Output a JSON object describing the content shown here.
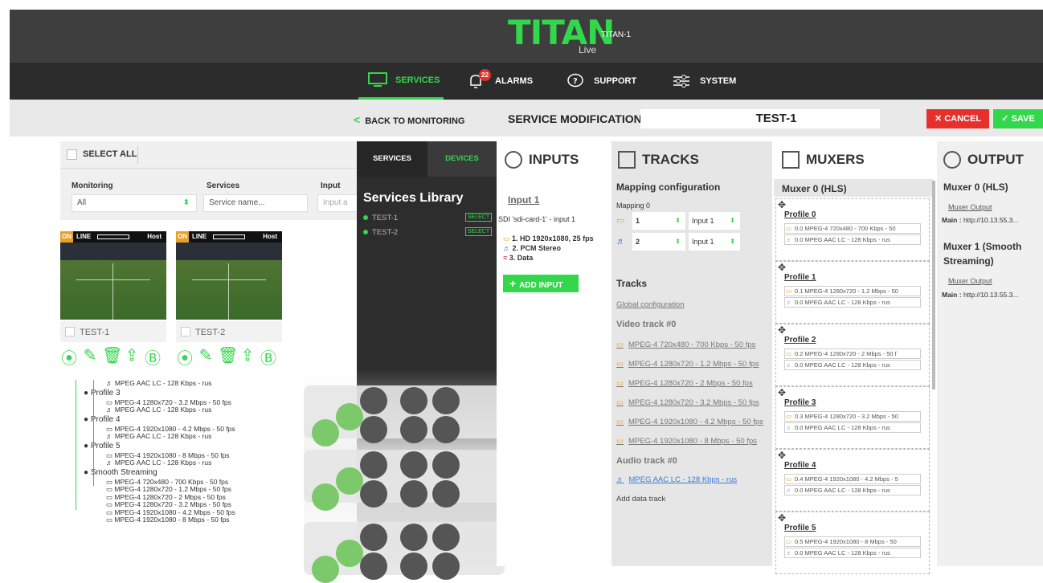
{
  "header": {
    "logo": "TITAN",
    "logo_sub": "Live",
    "device": "TITAN-1"
  },
  "nav": {
    "services": "SERVICES",
    "alarms": "ALARMS",
    "alarm_count": "22",
    "support": "SUPPORT",
    "system": "SYSTEM"
  },
  "toolbar": {
    "back": "BACK TO MONITORING",
    "modification_label": "SERVICE MODIFICATION :",
    "service_name": "TEST-1",
    "cancel": "CANCEL",
    "save": "SAVE"
  },
  "monitoring": {
    "select_all": "SELECT ALL",
    "filter_monitoring_label": "Monitoring",
    "filter_monitoring_value": "All",
    "filter_services_label": "Services",
    "filter_services_placeholder": "Service name...",
    "filter_input_label": "Input",
    "filter_input_placeholder": "Input a",
    "cards": [
      {
        "name": "TEST-1",
        "on": "ON",
        "line": "LINE",
        "host": "Host"
      },
      {
        "name": "TEST-2",
        "on": "ON",
        "line": "LINE",
        "host": "Host"
      }
    ]
  },
  "tree": {
    "items": [
      {
        "c": "l1",
        "t": "♬ MPEG AAC LC - 128 Kbps - rus"
      },
      {
        "c": "grp",
        "t": "● Profile 3"
      },
      {
        "c": "l1",
        "t": "▭ MPEG-4 1280x720 - 3.2 Mbps - 50 fps"
      },
      {
        "c": "l1",
        "t": "♬ MPEG AAC LC - 128 Kbps - rus"
      },
      {
        "c": "grp",
        "t": "● Profile 4"
      },
      {
        "c": "l1",
        "t": "▭ MPEG-4 1920x1080 - 4.2 Mbps - 50 fps"
      },
      {
        "c": "l1",
        "t": "♬ MPEG AAC LC - 128 Kbps - rus"
      },
      {
        "c": "grp",
        "t": "● Profile 5"
      },
      {
        "c": "l1",
        "t": "▭ MPEG-4 1920x1080 - 8 Mbps - 50 fps"
      },
      {
        "c": "l1",
        "t": "♬ MPEG AAC LC - 128 Kbps - rus"
      },
      {
        "c": "grp",
        "t": "● Smooth Streaming"
      },
      {
        "c": "l1",
        "t": "▭ MPEG-4 720x480 - 700 Kbps - 50 fps"
      },
      {
        "c": "l1",
        "t": "▭ MPEG-4 1280x720 - 1.2 Mbps - 50 fps"
      },
      {
        "c": "l1",
        "t": "▭ MPEG-4 1280x720 - 2 Mbps - 50 fps"
      },
      {
        "c": "l1",
        "t": "▭ MPEG-4 1280x720 - 3.2 Mbps - 50 fps"
      },
      {
        "c": "l1",
        "t": "▭ MPEG-4 1920x1080 - 4.2 Mbps - 50 fps"
      },
      {
        "c": "l1",
        "t": "▭ MPEG-4 1920x1080 - 8 Mbps - 50 fps"
      }
    ]
  },
  "library": {
    "tab_services": "SERVICES",
    "tab_devices": "DEVICES",
    "title": "Services Library",
    "select": "SELECT",
    "items": [
      "TEST-1",
      "TEST-2"
    ]
  },
  "inputs": {
    "title": "INPUTS",
    "input_name": "Input 1",
    "input_desc": "SDI 'sdi-card-1' - input 1",
    "lines": [
      "1. HD 1920x1080, 25 fps",
      "2. PCM Stereo",
      "3. Data"
    ],
    "add": "ADD INPUT"
  },
  "tracks": {
    "title": "TRACKS",
    "mapping_title": "Mapping configuration",
    "mapping_label": "Mapping 0",
    "map_rows": [
      {
        "a": "1",
        "b": "Input 1"
      },
      {
        "a": "2",
        "b": "Input 1"
      }
    ],
    "tracks_title": "Tracks",
    "global": "Global configuration",
    "video_title": "Video track #0",
    "video": [
      "MPEG-4 720x480 - 700 Kbps - 50 fps",
      "MPEG-4 1280x720 - 1.2 Mbps - 50 fps",
      "MPEG-4 1280x720 - 2 Mbps - 50 fps",
      "MPEG-4 1280x720 - 3.2 Mbps - 50 fps",
      "MPEG-4 1920x1080 - 4.2 Mbps - 50 fps",
      "MPEG-4 1920x1080 - 8 Mbps - 50 fps"
    ],
    "audio_title": "Audio track #0",
    "audio": "MPEG AAC LC - 128 Kbps - rus",
    "add_data": "Add data track"
  },
  "muxers": {
    "title": "MUXERS",
    "mux0": "Muxer 0 (HLS)",
    "profiles": [
      {
        "name": "Profile 0",
        "v": "0.0 MPEG-4 720x480 - 700 Kbps - 50",
        "a": "0.0 MPEG AAC LC - 128 Kbps - rus"
      },
      {
        "name": "Profile 1",
        "v": "0.1 MPEG-4 1280x720 - 1.2 Mbps - 50",
        "a": "0.0 MPEG AAC LC - 128 Kbps - rus"
      },
      {
        "name": "Profile 2",
        "v": "0.2 MPEG-4 1280x720 - 2 Mbps - 50 f",
        "a": "0.0 MPEG AAC LC - 128 Kbps - rus"
      },
      {
        "name": "Profile 3",
        "v": "0.3 MPEG-4 1280x720 - 3.2 Mbps - 50",
        "a": "0.0 MPEG AAC LC - 128 Kbps - rus"
      },
      {
        "name": "Profile 4",
        "v": "0.4 MPEG-4 1920x1080 - 4.2 Mbps - 5",
        "a": "0.0 MPEG AAC LC - 128 Kbps - rus"
      },
      {
        "name": "Profile 5",
        "v": "0.5 MPEG-4 1920x1080 - 8 Mbps - 50",
        "a": "0.0 MPEG AAC LC - 128 Kbps - rus"
      }
    ]
  },
  "output": {
    "title": "OUTPUT",
    "m0": "Muxer 0 (HLS)",
    "m1": "Muxer 1 (Smooth Streaming)",
    "muxer_output": "Muxer Output",
    "main_label": "Main :",
    "main_url": "http://10.13.55.3..."
  }
}
